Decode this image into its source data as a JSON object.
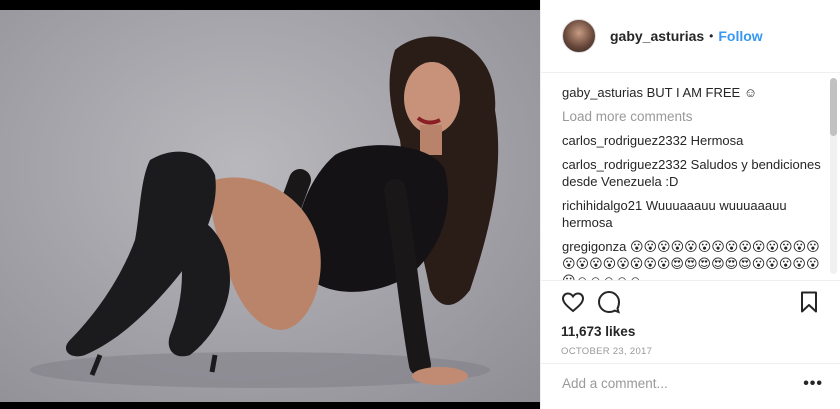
{
  "post": {
    "username": "gaby_asturias",
    "separator": "•",
    "follow_label": "Follow",
    "likes": "11,673 likes",
    "date": "OCTOBER 23, 2017",
    "add_comment_placeholder": "Add a comment...",
    "more_label": "•••"
  },
  "caption": {
    "user": "gaby_asturias",
    "text": " BUT I AM FREE ☺"
  },
  "load_more": "Load more comments",
  "comments": [
    {
      "user": "carlos_rodriguez2332",
      "text": " Hermosa"
    },
    {
      "user": "carlos_rodriguez2332",
      "text": " Saludos y bendiciones desde Venezuela :D"
    },
    {
      "user": "richihidalgo21",
      "text": " Wuuuaaauu wuuuaaauu hermosa"
    },
    {
      "user": "gregigonza",
      "text": " 😮😮😮😮😮😮😮😮😮😮😮😮😮😮😮😮😮😮😮😮😮😮😍😍😍😍😍😍😮😮😮😮😮😮☺☺☺☺☺"
    }
  ],
  "icons": [
    "heart-icon",
    "comment-icon",
    "bookmark-icon"
  ],
  "colors": {
    "follow": "#3897f0",
    "muted": "#999999",
    "text": "#262626"
  }
}
